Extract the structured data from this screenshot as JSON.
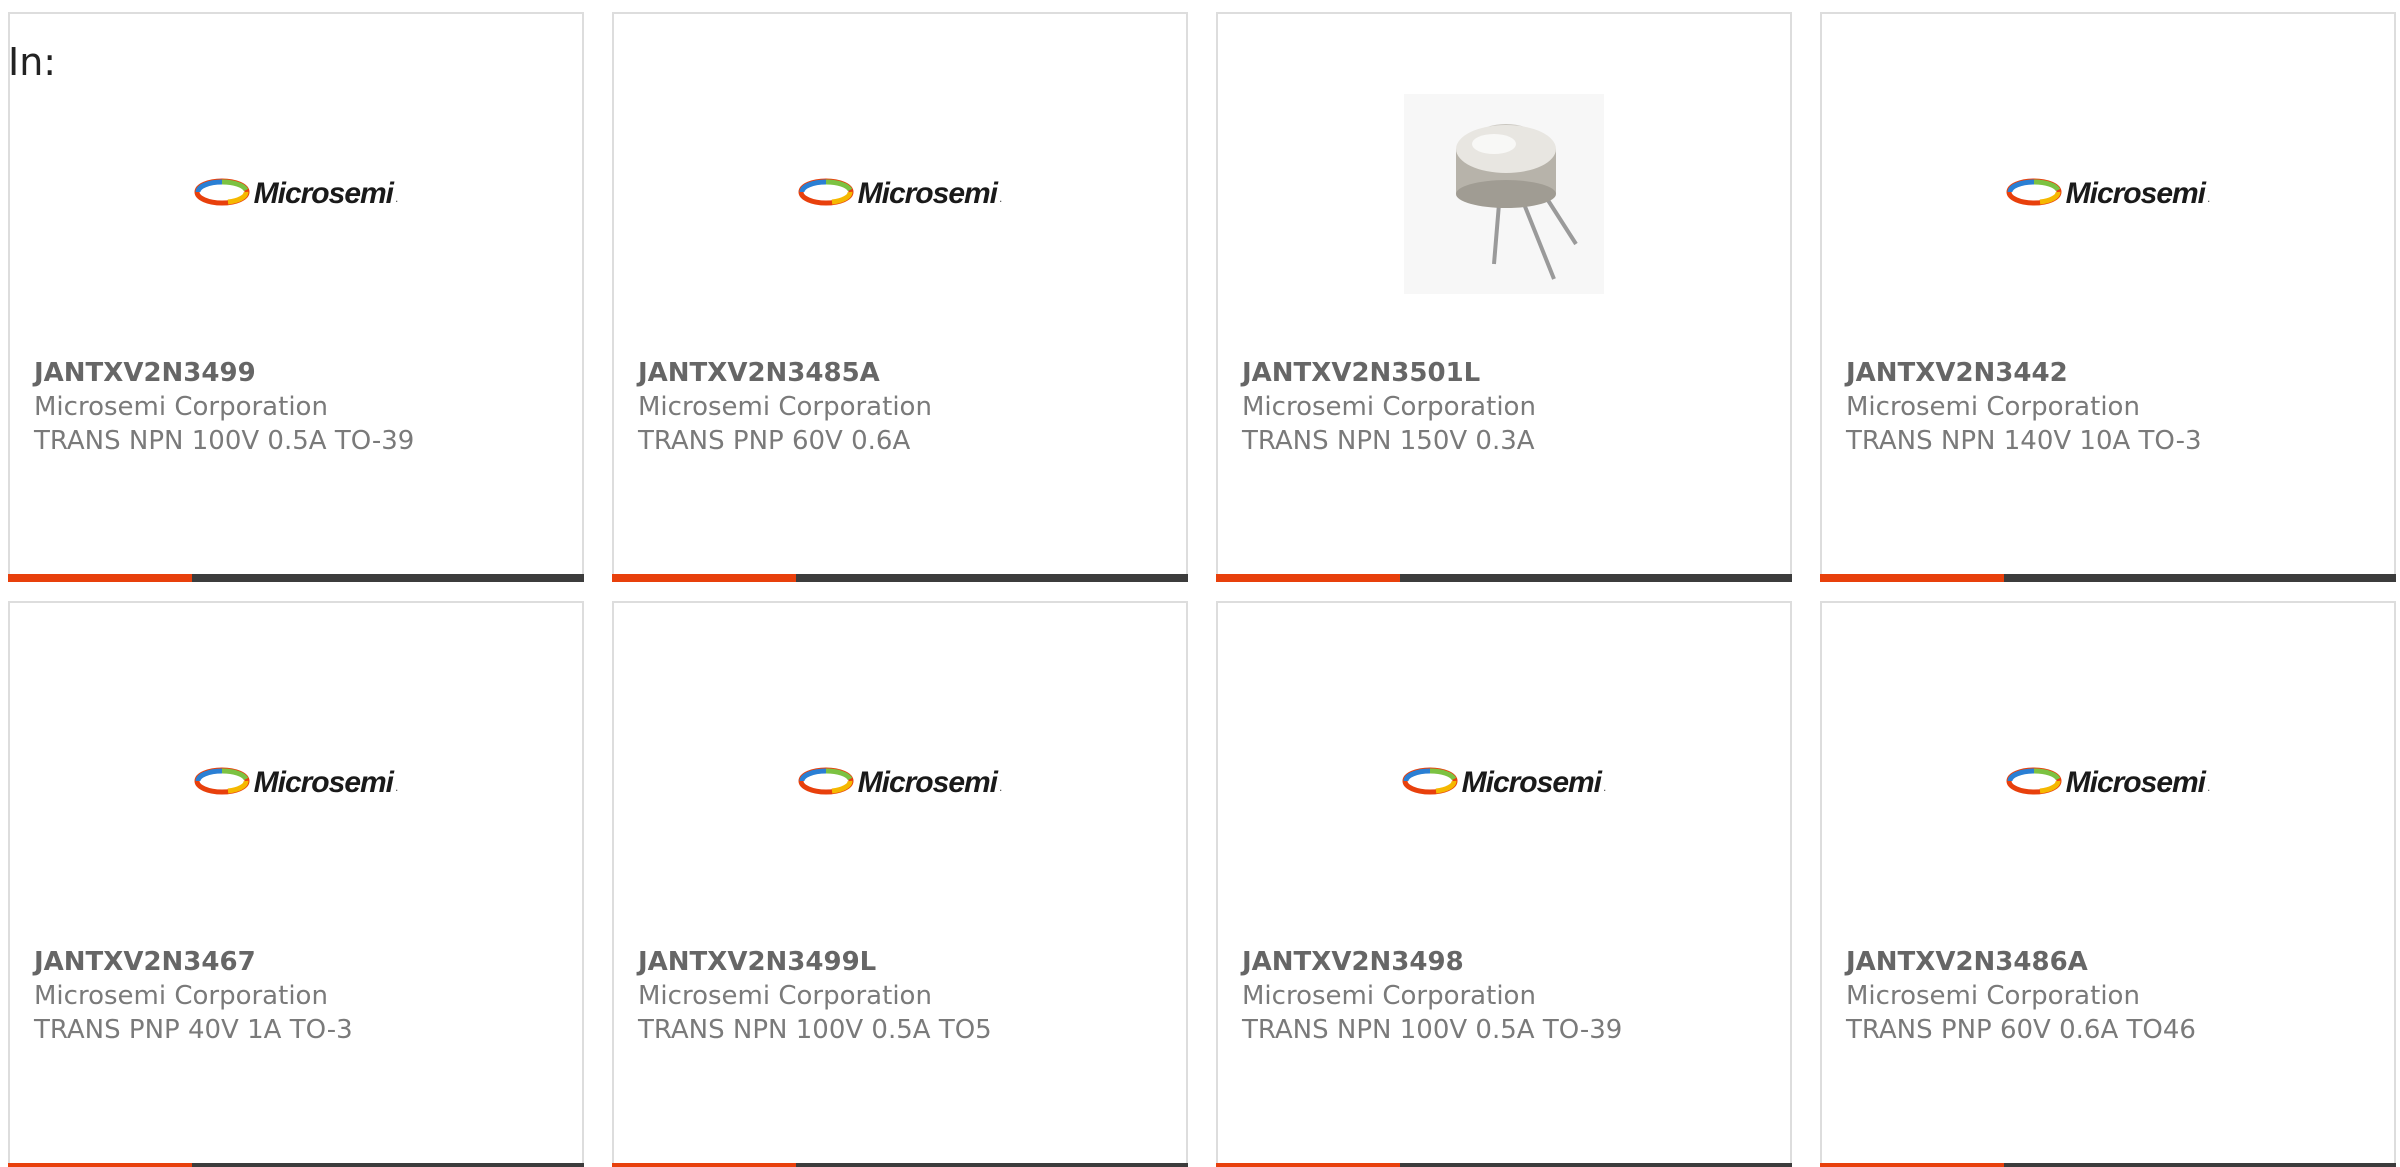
{
  "header": {
    "label": "In:"
  },
  "colors": {
    "accent": "#e8400c",
    "dark": "#3c3c3c"
  },
  "cards": [
    {
      "part": "JANTXV2N3499",
      "manufacturer": "Microsemi Corporation",
      "description": "TRANS NPN 100V 0.5A TO-39",
      "media": "logo",
      "logo_text": "Microsemi"
    },
    {
      "part": "JANTXV2N3485A",
      "manufacturer": "Microsemi Corporation",
      "description": "TRANS PNP 60V 0.6A",
      "media": "logo",
      "logo_text": "Microsemi"
    },
    {
      "part": "JANTXV2N3501L",
      "manufacturer": "Microsemi Corporation",
      "description": "TRANS NPN 150V 0.3A",
      "media": "photo",
      "logo_text": ""
    },
    {
      "part": "JANTXV2N3442",
      "manufacturer": "Microsemi Corporation",
      "description": "TRANS NPN 140V 10A TO-3",
      "media": "logo",
      "logo_text": "Microsemi"
    },
    {
      "part": "JANTXV2N3467",
      "manufacturer": "Microsemi Corporation",
      "description": "TRANS PNP 40V 1A TO-3",
      "media": "logo",
      "logo_text": "Microsemi"
    },
    {
      "part": "JANTXV2N3499L",
      "manufacturer": "Microsemi Corporation",
      "description": "TRANS NPN 100V 0.5A TO5",
      "media": "logo",
      "logo_text": "Microsemi"
    },
    {
      "part": "JANTXV2N3498",
      "manufacturer": "Microsemi Corporation",
      "description": "TRANS NPN 100V 0.5A TO-39",
      "media": "logo",
      "logo_text": "Microsemi"
    },
    {
      "part": "JANTXV2N3486A",
      "manufacturer": "Microsemi Corporation",
      "description": "TRANS PNP 60V 0.6A TO46",
      "media": "logo",
      "logo_text": "Microsemi"
    }
  ]
}
